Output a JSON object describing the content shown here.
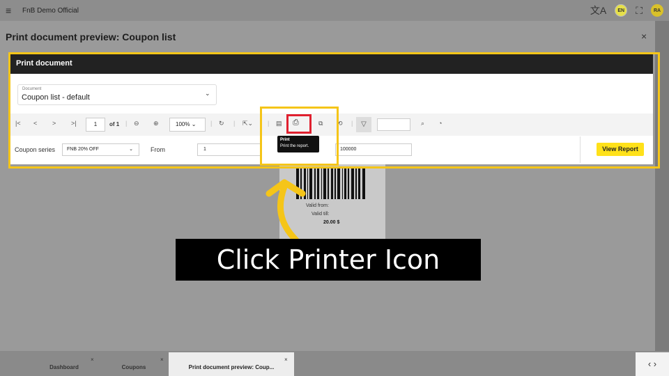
{
  "topbar": {
    "menu_icon": "hamburger-icon",
    "app_title": "FnB Demo Official",
    "lang": "EN",
    "avatar": "RA"
  },
  "dialog": {
    "title": "Print document preview: Coupon list",
    "close": "×"
  },
  "print_panel": {
    "header": "Print document",
    "document_label": "Document",
    "document_value": "Coupon list - default"
  },
  "toolbar": {
    "page_current": "1",
    "page_of": "of 1",
    "zoom": "100%",
    "tooltip_title": "Print",
    "tooltip_desc": "Print the report."
  },
  "params": {
    "coupon_series_label": "Coupon series",
    "coupon_series_value": "FNB 20% OFF",
    "from_label": "From",
    "from_value": "1",
    "to_value": "100000",
    "view_report": "View Report"
  },
  "report": {
    "valid_from": "Valid from:",
    "valid_till": "Valid till:",
    "price": "20.00 $"
  },
  "caption": "Click Printer Icon",
  "tabs": [
    {
      "label": "Dashboard"
    },
    {
      "label": "Coupons"
    },
    {
      "label": "Print document preview: Coup..."
    }
  ],
  "colors": {
    "highlight": "#f5c518",
    "printer_outline": "#e0202f",
    "view_report": "#ffe11a"
  }
}
